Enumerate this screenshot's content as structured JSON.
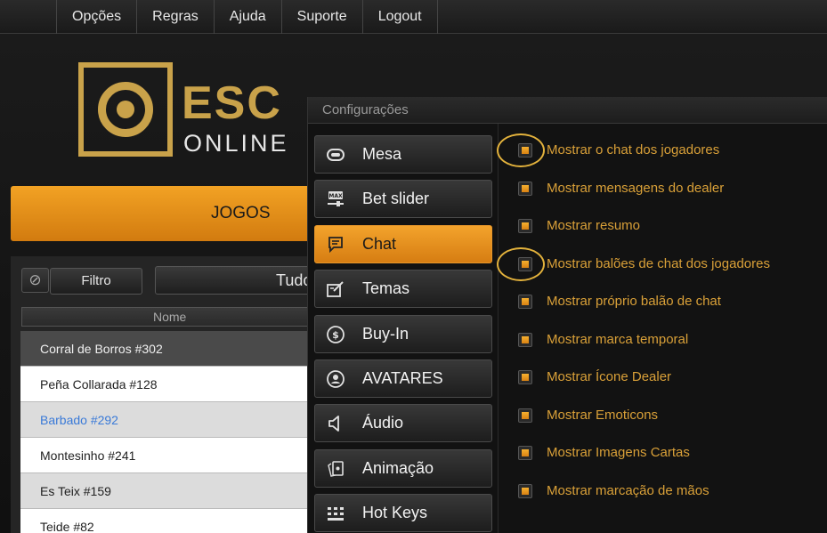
{
  "topmenu": {
    "items": [
      "Opções",
      "Regras",
      "Ajuda",
      "Suporte",
      "Logout"
    ]
  },
  "logo": {
    "brand": "ESC",
    "sub": "ONLINE"
  },
  "lobby": {
    "tab_label": "JOGOS",
    "filter_label": "Filtro",
    "filter_value": "Tudo",
    "column_header": "Nome",
    "games": [
      "Corral de Borros #302",
      "Peña Collarada #128",
      "Barbado #292",
      "Montesinho #241",
      "Es Teix #159",
      "Teide #82"
    ]
  },
  "dialog": {
    "title": "Configurações",
    "nav": [
      {
        "label": "Mesa",
        "icon": "table-icon",
        "active": false
      },
      {
        "label": "Bet slider",
        "icon": "bet-slider-icon",
        "active": false
      },
      {
        "label": "Chat",
        "icon": "chat-icon",
        "active": true
      },
      {
        "label": "Temas",
        "icon": "themes-icon",
        "active": false
      },
      {
        "label": "Buy-In",
        "icon": "buy-in-icon",
        "active": false
      },
      {
        "label": "AVATARES",
        "icon": "avatar-icon",
        "active": false
      },
      {
        "label": "Áudio",
        "icon": "audio-icon",
        "active": false
      },
      {
        "label": "Animação",
        "icon": "animation-icon",
        "active": false
      },
      {
        "label": "Hot Keys",
        "icon": "hotkeys-icon",
        "active": false
      }
    ],
    "options": [
      {
        "label": "Mostrar o chat dos jogadores",
        "checked": true,
        "highlighted": true
      },
      {
        "label": "Mostrar mensagens do dealer",
        "checked": true,
        "highlighted": false
      },
      {
        "label": "Mostrar resumo",
        "checked": true,
        "highlighted": false
      },
      {
        "label": "Mostrar balões de chat dos jogadores",
        "checked": true,
        "highlighted": true
      },
      {
        "label": "Mostrar próprio balão de chat",
        "checked": true,
        "highlighted": false
      },
      {
        "label": "Mostrar marca temporal",
        "checked": true,
        "highlighted": false
      },
      {
        "label": "Mostrar Ícone Dealer",
        "checked": true,
        "highlighted": false
      },
      {
        "label": "Mostrar Emoticons",
        "checked": true,
        "highlighted": false
      },
      {
        "label": "Mostrar Imagens Cartas",
        "checked": true,
        "highlighted": false
      },
      {
        "label": "Mostrar marcação de mãos",
        "checked": true,
        "highlighted": false
      }
    ]
  },
  "colors": {
    "accent": "#e8901a",
    "option_text": "#d9a038",
    "highlight_ring": "#e3b23c",
    "logo_gold": "#c9a24a"
  }
}
